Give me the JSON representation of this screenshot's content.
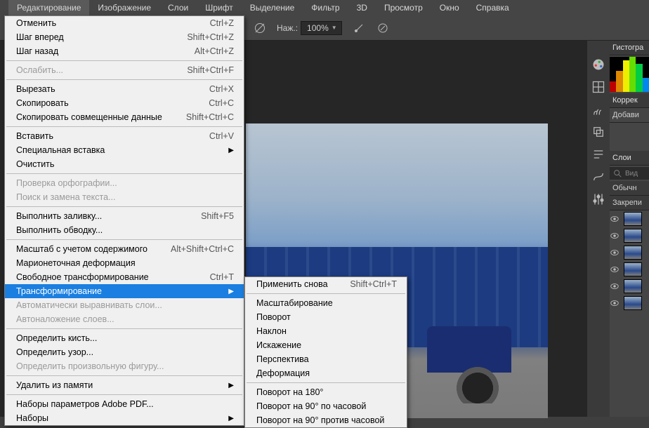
{
  "menubar": {
    "items": [
      "Редактирование",
      "Изображение",
      "Слои",
      "Шрифт",
      "Выделение",
      "Фильтр",
      "3D",
      "Просмотр",
      "Окно",
      "Справка"
    ]
  },
  "toolbar": {
    "pressure_label": "Наж.:",
    "zoom_value": "100%"
  },
  "edit_menu": {
    "groups": [
      [
        {
          "label": "Отменить",
          "shortcut": "Ctrl+Z",
          "enabled": true
        },
        {
          "label": "Шаг вперед",
          "shortcut": "Shift+Ctrl+Z",
          "enabled": true
        },
        {
          "label": "Шаг назад",
          "shortcut": "Alt+Ctrl+Z",
          "enabled": true
        }
      ],
      [
        {
          "label": "Ослабить...",
          "shortcut": "Shift+Ctrl+F",
          "enabled": false
        }
      ],
      [
        {
          "label": "Вырезать",
          "shortcut": "Ctrl+X",
          "enabled": true
        },
        {
          "label": "Скопировать",
          "shortcut": "Ctrl+C",
          "enabled": true
        },
        {
          "label": "Скопировать совмещенные данные",
          "shortcut": "Shift+Ctrl+C",
          "enabled": true
        }
      ],
      [
        {
          "label": "Вставить",
          "shortcut": "Ctrl+V",
          "enabled": true
        },
        {
          "label": "Специальная вставка",
          "submenu": true,
          "enabled": true
        },
        {
          "label": "Очистить",
          "enabled": true
        }
      ],
      [
        {
          "label": "Проверка орфографии...",
          "enabled": false
        },
        {
          "label": "Поиск и замена текста...",
          "enabled": false
        }
      ],
      [
        {
          "label": "Выполнить заливку...",
          "shortcut": "Shift+F5",
          "enabled": true
        },
        {
          "label": "Выполнить обводку...",
          "enabled": true
        }
      ],
      [
        {
          "label": "Масштаб с учетом содержимого",
          "shortcut": "Alt+Shift+Ctrl+C",
          "enabled": true
        },
        {
          "label": "Марионеточная деформация",
          "enabled": true
        },
        {
          "label": "Свободное трансформирование",
          "shortcut": "Ctrl+T",
          "enabled": true
        },
        {
          "label": "Трансформирование",
          "submenu": true,
          "enabled": true,
          "highlight": true
        },
        {
          "label": "Автоматически выравнивать слои...",
          "enabled": false
        },
        {
          "label": "Автоналожение слоев...",
          "enabled": false
        }
      ],
      [
        {
          "label": "Определить кисть...",
          "enabled": true
        },
        {
          "label": "Определить узор...",
          "enabled": true
        },
        {
          "label": "Определить произвольную фигуру...",
          "enabled": false
        }
      ],
      [
        {
          "label": "Удалить из памяти",
          "submenu": true,
          "enabled": true
        }
      ],
      [
        {
          "label": "Наборы параметров Adobe PDF...",
          "enabled": true
        },
        {
          "label": "Наборы",
          "submenu": true,
          "enabled": true
        }
      ]
    ]
  },
  "transform_submenu": {
    "groups": [
      [
        {
          "label": "Применить снова",
          "shortcut": "Shift+Ctrl+T"
        }
      ],
      [
        {
          "label": "Масштабирование"
        },
        {
          "label": "Поворот"
        },
        {
          "label": "Наклон"
        },
        {
          "label": "Искажение"
        },
        {
          "label": "Перспектива"
        },
        {
          "label": "Деформация"
        }
      ],
      [
        {
          "label": "Поворот на 180°"
        },
        {
          "label": "Поворот на 90° по часовой"
        },
        {
          "label": "Поворот на 90° против часовой"
        }
      ]
    ]
  },
  "right_dock": {
    "panel_histogram": "Гистогра",
    "panel_correction": "Коррек",
    "panel_add": "Добави",
    "panel_layers": "Слои",
    "search_placeholder": "Вид",
    "blend_mode": "Обычн",
    "lock_label": "Закрепи"
  }
}
